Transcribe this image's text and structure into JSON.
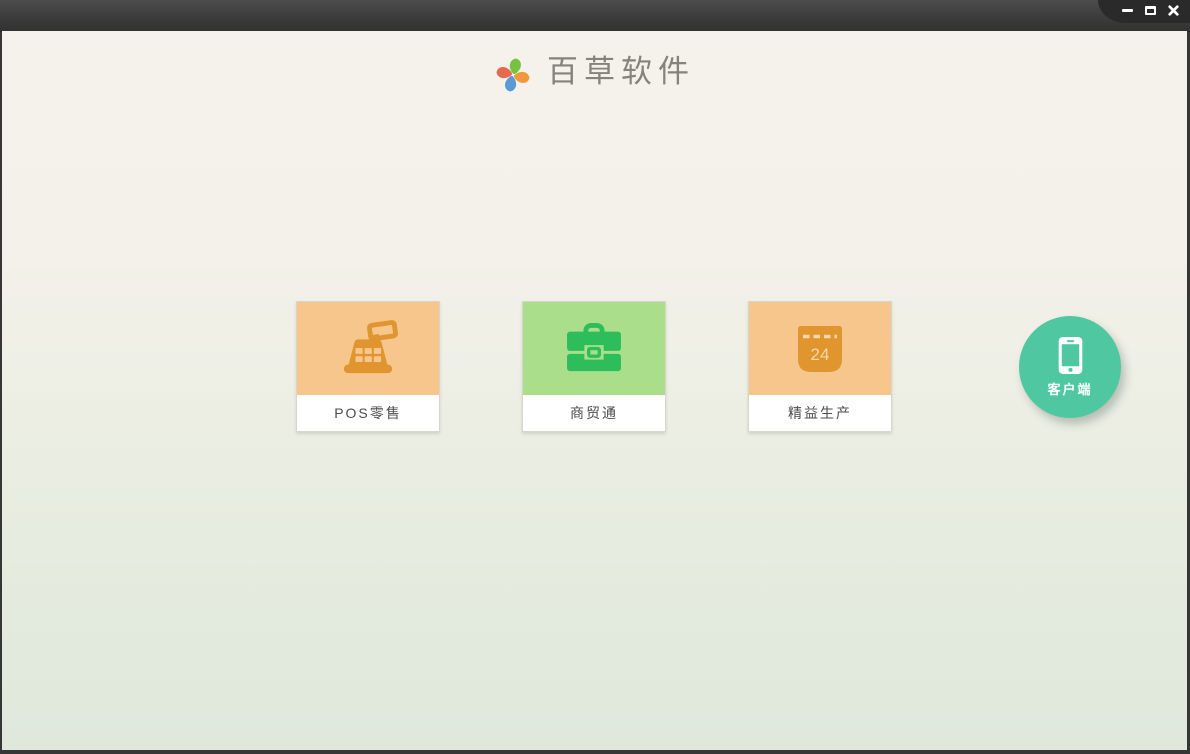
{
  "window": {
    "controls": {
      "minimize_icon": "minimize-bar",
      "maximize_icon": "maximize-box",
      "close_icon": "close-x"
    }
  },
  "header": {
    "app_name": "百草软件",
    "logo_icon": "pinwheel-logo",
    "logo_colors": {
      "top": "#79c140",
      "right": "#f0983d",
      "bottom": "#5b9bd5",
      "left": "#e66a50"
    }
  },
  "products": [
    {
      "label": "POS零售",
      "icon": "cash-register-icon",
      "tile_color": "#f7c68d",
      "icon_color": "#e0952f"
    },
    {
      "label": "商贸通",
      "icon": "briefcase-icon",
      "tile_color": "#abde8b",
      "icon_color": "#2dbd5b"
    },
    {
      "label": "精益生产",
      "icon": "calendar-icon",
      "tile_color": "#f7c68d",
      "icon_color": "#e0952f",
      "calendar_number": "24",
      "calendar_accent": "#f6d9a8"
    }
  ],
  "client_button": {
    "label": "客户端",
    "icon": "smartphone-icon",
    "color": "#4fc8a1"
  },
  "colors": {
    "titlebar": "#3c3c3c",
    "titlebar_corner": "#2a2a2a",
    "background_top": "#f4f2eb",
    "background_bottom": "#dee8db",
    "card_label_text": "#4c4c4c"
  }
}
